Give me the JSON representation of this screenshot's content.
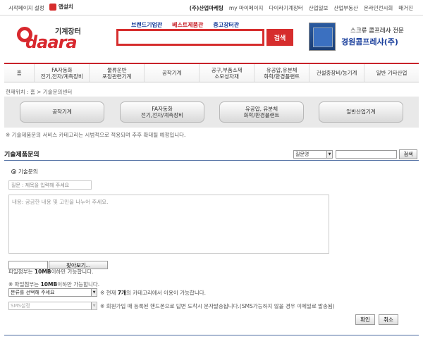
{
  "topbar": {
    "start_page": "시작페이지 설정",
    "app_install": "앱설치",
    "links": [
      "(주)산업마케팅",
      "my 마이페이지",
      "다이라기계장터",
      "산업일보",
      "산업부동산",
      "온라인전시회",
      "매거진"
    ]
  },
  "header": {
    "logo_kr": "기계장터",
    "logo_en": "daara",
    "keyword_tabs": [
      "브랜드기업관",
      "베스트제품관",
      "중고장터관"
    ],
    "search_value": "",
    "search_button": "검색",
    "ad_sub": "스크류 콤프레샤 전문",
    "ad_main": "경원콤프레샤(주)"
  },
  "categories": [
    "홈",
    "FA자동화\n전기,전자/계측장비",
    "물류운반\n포장관련기계",
    "공작기계",
    "공구,부품소재\n소모성자재",
    "유공압,유분체\n화학/환경플랜트",
    "건설중장비/농기계",
    "일반 기타산업"
  ],
  "breadcrumb": "현재위치 : 홈 > 기술문의센터",
  "sub_categories": [
    "공작기계",
    "FA자동화\n전기,전자/계측장비",
    "유공압, 유분체\n화학/환경플랜트",
    "일반산업기계"
  ],
  "notice": "※ 기술제품문의 서비스 카테고리는 시범적으로 적용되며 추후 확대될 예정입니다.",
  "section": {
    "title": "기술제품문의",
    "search_select": "질문명",
    "search_keyword": "",
    "search_button": "검색"
  },
  "form": {
    "radio_label": "기술문의",
    "title_placeholder": "질문 : 제목을 입력해 주세요",
    "content_placeholder": "내용: 궁금한 내용 및 고민을 나누어 주세요.",
    "file_button": "찾아보기...",
    "file_note_prefix": "파일첨부는 ",
    "file_note_size": "10MB",
    "file_note_suffix": "이하만 가능합니다.",
    "file_note2_prefix": "※ 파일첨부는 ",
    "category_select": "분류를 선택해 주세요",
    "category_note_prefix": "※ 현재 ",
    "category_count": "7개",
    "category_note_suffix": "의 카테고리에서 이용이 가능합니다.",
    "sms_select": "SMS설정",
    "sms_note": "※ 회원가입 때 등록된 핸드폰으로 답변 도착시 문자발송됩니다.(SMS가능하지 않을 경우 이메일로 발송됨)",
    "ok_button": "확인",
    "cancel_button": "취소"
  },
  "colors": {
    "brand_red": "#d62d2d",
    "link_blue": "#1a3f9c"
  }
}
